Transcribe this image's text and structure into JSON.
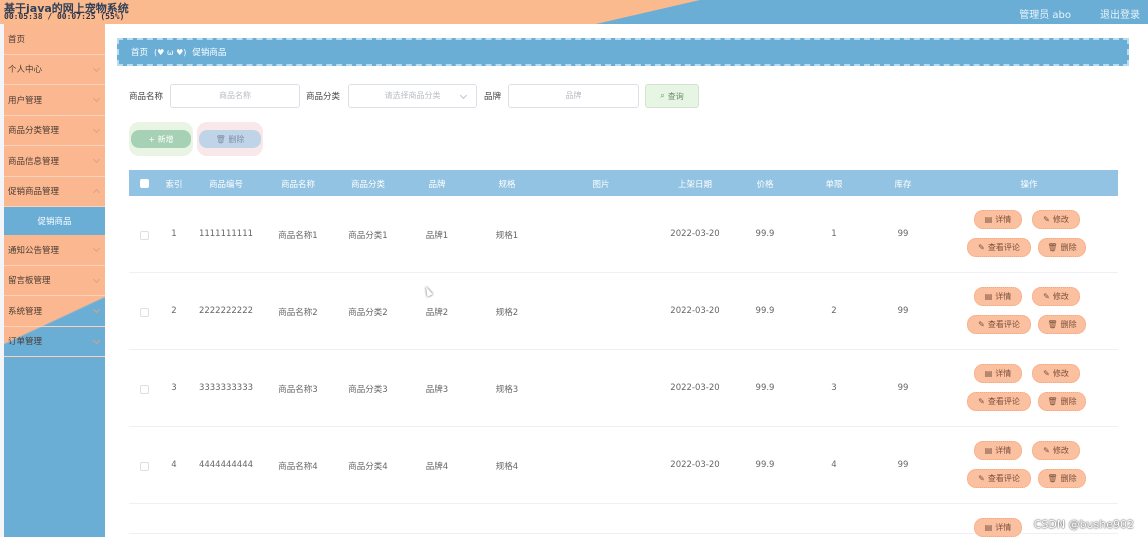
{
  "header": {
    "title": "基于java的网上宠物系统",
    "recorder_text": "00:05:38 / 00:07:25 (55%)",
    "user_label": "管理员 abo",
    "logout_label": "退出登录",
    "colors": {
      "peach": "#fbb98e",
      "blue": "#6aaed6"
    }
  },
  "sidebar": {
    "items": [
      {
        "label": "首页",
        "has_arrow": false
      },
      {
        "label": "个人中心",
        "has_arrow": true
      },
      {
        "label": "用户管理",
        "has_arrow": true
      },
      {
        "label": "商品分类管理",
        "has_arrow": true
      },
      {
        "label": "商品信息管理",
        "has_arrow": true
      },
      {
        "label": "促销商品管理",
        "has_arrow": true
      },
      {
        "label": "促销商品",
        "sub": true,
        "active": true
      },
      {
        "label": "通知公告管理",
        "has_arrow": true
      },
      {
        "label": "留言板管理",
        "has_arrow": true
      },
      {
        "label": "系统管理",
        "has_arrow": true
      },
      {
        "label": "订单管理",
        "has_arrow": true
      }
    ]
  },
  "breadcrumb": {
    "home": "首页",
    "separator": "(♥ ω ♥)",
    "current": "促销商品"
  },
  "search": {
    "name_label": "商品名称",
    "name_placeholder": "商品名称",
    "category_label": "商品分类",
    "category_placeholder": "请选择商品分类",
    "brand_label": "品牌",
    "brand_placeholder": "品牌",
    "search_button": "查询"
  },
  "actions": {
    "add_label": "新增",
    "delete_label": "删除"
  },
  "table": {
    "columns": [
      "索引",
      "商品编号",
      "商品名称",
      "商品分类",
      "品牌",
      "规格",
      "图片",
      "上架日期",
      "价格",
      "单限",
      "库存",
      "操作"
    ],
    "rows": [
      {
        "index": "1",
        "code": "1111111111",
        "name": "商品名称1",
        "category": "商品分类1",
        "brand": "品牌1",
        "spec": "规格1",
        "date": "2022-03-20",
        "price": "99.9",
        "limit": "1",
        "stock": "99"
      },
      {
        "index": "2",
        "code": "2222222222",
        "name": "商品名称2",
        "category": "商品分类2",
        "brand": "品牌2",
        "spec": "规格2",
        "date": "2022-03-20",
        "price": "99.9",
        "limit": "2",
        "stock": "99"
      },
      {
        "index": "3",
        "code": "3333333333",
        "name": "商品名称3",
        "category": "商品分类3",
        "brand": "品牌3",
        "spec": "规格3",
        "date": "2022-03-20",
        "price": "99.9",
        "limit": "3",
        "stock": "99"
      },
      {
        "index": "4",
        "code": "4444444444",
        "name": "商品名称4",
        "category": "商品分类4",
        "brand": "品牌4",
        "spec": "规格4",
        "date": "2022-03-20",
        "price": "99.9",
        "limit": "4",
        "stock": "99"
      }
    ],
    "row_actions": {
      "detail": "详情",
      "edit": "修改",
      "comments": "查看评论",
      "delete": "删除"
    }
  },
  "watermark": "CSDN @bushe902"
}
